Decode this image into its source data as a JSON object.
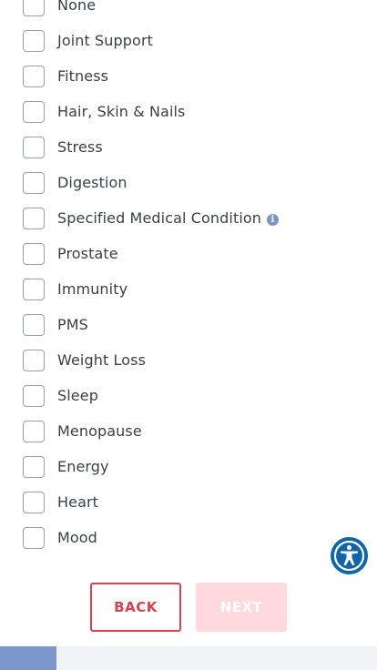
{
  "options": [
    {
      "label": "None"
    },
    {
      "label": "Joint Support"
    },
    {
      "label": "Fitness"
    },
    {
      "label": "Hair, Skin & Nails"
    },
    {
      "label": "Stress"
    },
    {
      "label": "Digestion"
    },
    {
      "label": "Specified Medical Condition",
      "info_icon": "info-icon"
    },
    {
      "label": "Prostate"
    },
    {
      "label": "Immunity"
    },
    {
      "label": "PMS"
    },
    {
      "label": "Weight Loss"
    },
    {
      "label": "Sleep"
    },
    {
      "label": "Menopause"
    },
    {
      "label": "Energy"
    },
    {
      "label": "Heart"
    },
    {
      "label": "Mood"
    }
  ],
  "buttons": {
    "back_label": "BACK",
    "next_label": "NEXT"
  },
  "accessibility_button": {
    "icon": "accessibility-icon"
  },
  "progress": {
    "fraction": 0.15
  },
  "colors": {
    "accent": "#d9424f",
    "next_disabled": "#ffd9de",
    "accessibility": "#1064a8",
    "progress": "#7d97cd",
    "info": "#7a96c8"
  }
}
